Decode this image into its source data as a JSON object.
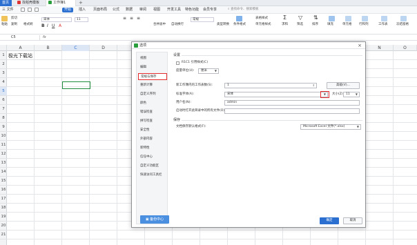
{
  "titlebar": {
    "home_label": "首页",
    "tabs": [
      {
        "label": "找稻壳模板"
      },
      {
        "label": "工作簿1"
      }
    ],
    "new_tab": "+"
  },
  "menubar": {
    "file": "三 文件",
    "items": [
      "开始",
      "插入",
      "页面布局",
      "公式",
      "数据",
      "审阅",
      "视图",
      "开发工具",
      "特色功能"
    ],
    "active_item": "开始",
    "member": "会员专享",
    "search_placeholder": "查找命令、搜索模板"
  },
  "ribbon": {
    "cut": "剪切",
    "paste": "粘贴",
    "copy": "复制",
    "format_painter": "格式刷",
    "font": "宋体",
    "font_size": "11",
    "merge_center": "合并居中",
    "auto_wrap": "自动换行",
    "number_format": "常规",
    "type_convert": "类型转换",
    "cond_format": "条件格式",
    "table_style": "表格样式",
    "cell_style": "单元格样式",
    "sum": "求和",
    "filter": "筛选",
    "sort": "排序",
    "fill": "填充",
    "cell": "单元格",
    "row_col": "行和列",
    "worksheet": "工作表",
    "freeze": "冻结窗格"
  },
  "formula_bar": {
    "name_box": "C5",
    "fx": "fx"
  },
  "grid": {
    "columns": [
      "A",
      "B",
      "C",
      "D",
      "N",
      "O"
    ],
    "rows": [
      "1",
      "2",
      "3",
      "4",
      "5",
      "6",
      "7",
      "8",
      "9",
      "10",
      "11",
      "12",
      "13",
      "14",
      "15",
      "16",
      "17",
      "18",
      "19",
      "20",
      "21"
    ],
    "a1_text": "极光下载站",
    "selected_cell": "C5"
  },
  "dialog": {
    "title": "选项",
    "close": "×",
    "sidebar": [
      {
        "label": "视图"
      },
      {
        "label": "编辑"
      },
      {
        "label": "常规与保存"
      },
      {
        "label": "重新计算"
      },
      {
        "label": "自定义序列"
      },
      {
        "label": "颜色"
      },
      {
        "label": "错误检查"
      },
      {
        "label": "拼写检查"
      },
      {
        "label": "安全性"
      },
      {
        "label": "外部内容"
      },
      {
        "label": "新特性"
      },
      {
        "label": "信任中心"
      },
      {
        "label": "自定义功能区"
      },
      {
        "label": "快速访问工具栏"
      }
    ],
    "active_sidebar": "常规与保存",
    "backup_center": "备份中心",
    "settings_section": "设置",
    "r1c1_label": "R1C1 引用样式(C)",
    "unit_label": "度量单位(U):",
    "unit_value": "厘米",
    "new_sheets_label": "新工作簿内的工作表数(S):",
    "new_sheets_value": "1",
    "advanced_button": "高级(V)...",
    "std_font_label": "标准字体(A):",
    "std_font_value": "宋体",
    "size_label": "大小(Z):",
    "size_value": "11",
    "username_label": "用户名(N):",
    "username_value": "admin",
    "default_path_label": "启动时打开此目录中的所有文件(O):",
    "default_path_value": "",
    "save_section": "保存",
    "file_format_label": "文档保存默认格式(F):",
    "file_format_value": "Microsoft Excel 文件(*.xlsx)",
    "ok_button": "确定",
    "cancel_button": "取消"
  },
  "colors": {
    "accent": "#2b6fd0",
    "highlight_red": "#e22a2a",
    "selection_green": "#1e8a3c"
  }
}
